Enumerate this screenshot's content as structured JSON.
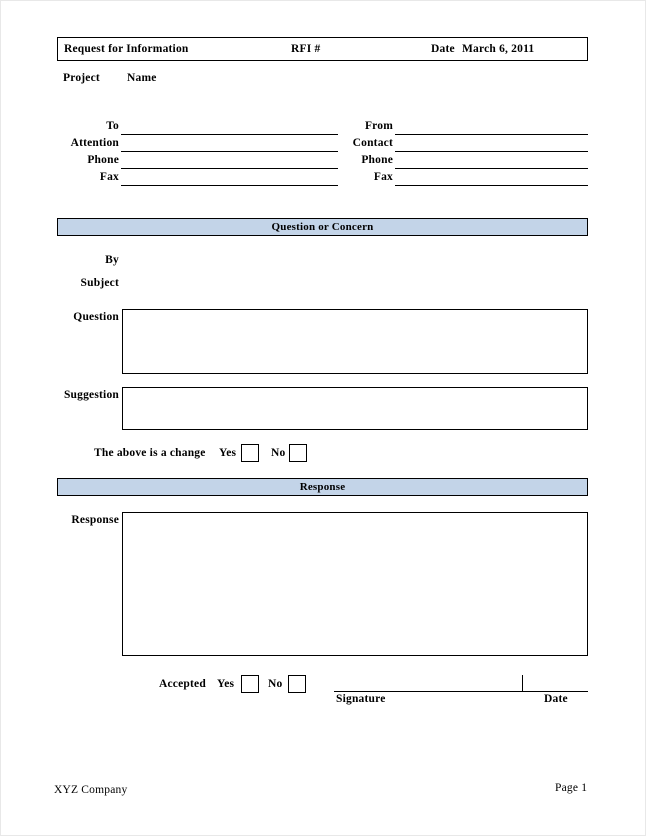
{
  "document": {
    "title": "Request for Information",
    "header": {
      "title": "Request for Information",
      "rfi_label": "RFI #",
      "date_label": "Date",
      "date_value": "March 6, 2011"
    },
    "project": {
      "label": "Project",
      "value": "Name"
    },
    "contacts": {
      "left": [
        {
          "label": "To",
          "value": ""
        },
        {
          "label": "Attention",
          "value": ""
        },
        {
          "label": "Phone",
          "value": ""
        },
        {
          "label": "Fax",
          "value": ""
        }
      ],
      "right": [
        {
          "label": "From",
          "value": ""
        },
        {
          "label": "Contact",
          "value": ""
        },
        {
          "label": "Phone",
          "value": ""
        },
        {
          "label": "Fax",
          "value": ""
        }
      ]
    },
    "question_section": {
      "banner": "Question or Concern",
      "by_label": "By",
      "by_value": "",
      "subject_label": "Subject",
      "subject_value": "",
      "question_label": "Question",
      "question_value": "",
      "suggestion_label": "Suggestion",
      "suggestion_value": "",
      "change_prompt": "The above is a change",
      "yes_label": "Yes",
      "no_label": "No"
    },
    "response_section": {
      "banner": "Response",
      "response_label": "Response",
      "response_value": "",
      "accepted_label": "Accepted",
      "yes_label": "Yes",
      "no_label": "No",
      "signature_label": "Signature",
      "date_label": "Date"
    },
    "footer": {
      "company": "XYZ Company",
      "page": "Page 1"
    },
    "colors": {
      "banner_fill": "#c3d4e8",
      "rule": "#000000",
      "page": "#ffffff"
    }
  }
}
